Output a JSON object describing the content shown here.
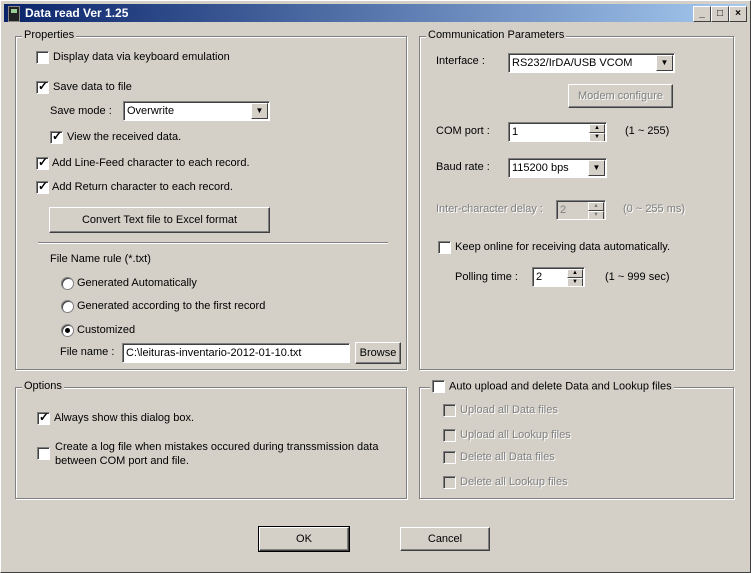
{
  "window": {
    "title": "Data read  Ver 1.25",
    "minimize": "_",
    "maximize": "□",
    "close": "×"
  },
  "properties": {
    "label": "Properties",
    "keyboard_emulation": "Display data via keyboard emulation",
    "save_to_file": "Save data to file",
    "save_mode_label": "Save mode :",
    "save_mode_value": "Overwrite",
    "view_received": "View the received data.",
    "add_line_feed": "Add Line-Feed character to each record.",
    "add_return": "Add Return character to each record.",
    "convert_button": "Convert Text file to Excel format",
    "file_name_rule": "File Name rule (*.txt)",
    "gen_auto": "Generated Automatically",
    "gen_first": "Generated according to the first record",
    "customized": "Customized",
    "file_name_label": "File name :",
    "file_name_value": "C:\\leituras-inventario-2012-01-10.txt",
    "browse": "Browse"
  },
  "comm": {
    "label": "Communication Parameters",
    "interface_label": "Interface :",
    "interface_value": "RS232/IrDA/USB VCOM",
    "modem_button": "Modem configure",
    "com_port_label": "COM port :",
    "com_port_value": "1",
    "com_port_range": "(1 ~ 255)",
    "baud_label": "Baud rate :",
    "baud_value": "115200 bps",
    "inter_char_label": "Inter-character delay :",
    "inter_char_value": "2",
    "inter_char_range": "(0 ~ 255 ms)",
    "keep_online": "Keep online for receiving data automatically.",
    "polling_label": "Polling time :",
    "polling_value": "2",
    "polling_range": "(1 ~ 999 sec)"
  },
  "options": {
    "label": "Options",
    "always_show": "Always show this dialog box.",
    "log_file_1": "Create a log file when mistakes occured during transsmission data",
    "log_file_2": "between COM port and file."
  },
  "upload": {
    "label": "Auto upload and delete Data and Lookup files",
    "upload_data": "Upload all Data files",
    "upload_lookup": "Upload all Lookup files",
    "delete_data": "Delete all Data files",
    "delete_lookup": "Delete all Lookup files"
  },
  "footer": {
    "ok": "OK",
    "cancel": "Cancel"
  }
}
